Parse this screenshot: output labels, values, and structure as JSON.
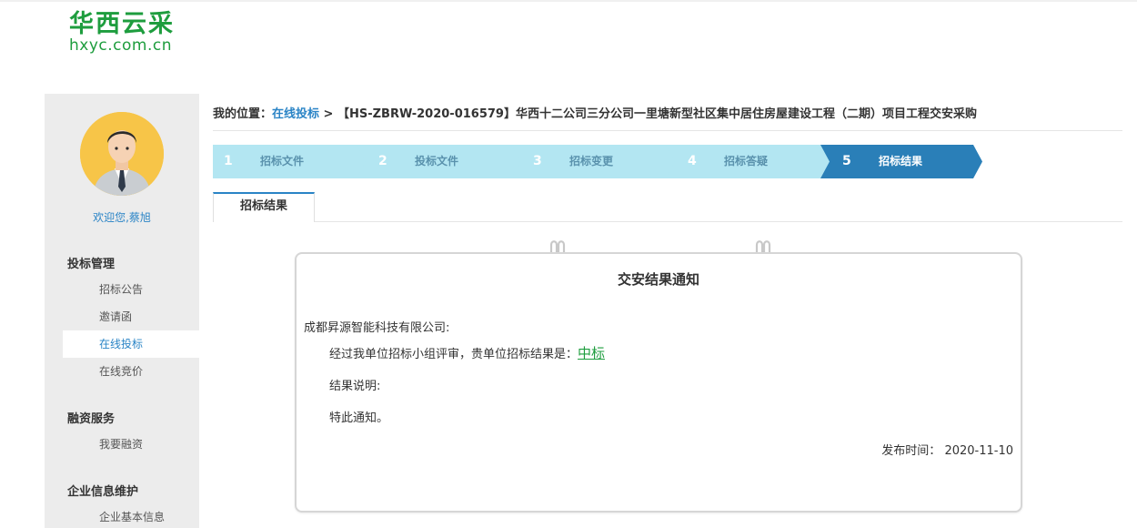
{
  "logo": {
    "cn": "华西云采",
    "en": "hxyc.com.cn"
  },
  "sidebar": {
    "welcome": "欢迎您,蔡旭",
    "groups": [
      {
        "title": "投标管理",
        "items": [
          "招标公告",
          "邀请函",
          "在线投标",
          "在线竞价"
        ]
      },
      {
        "title": "融资服务",
        "items": [
          "我要融资"
        ]
      },
      {
        "title": "企业信息维护",
        "items": [
          "企业基本信息"
        ]
      }
    ],
    "active_item": "在线投标"
  },
  "breadcrumb": {
    "prefix": "我的位置：",
    "link": "在线投标",
    "separator": " > ",
    "current": "【HS-ZBRW-2020-016579】华西十二公司三分公司一里塘新型社区集中居住房屋建设工程（二期）项目工程交安采购"
  },
  "steps": [
    {
      "num": "1",
      "label": "招标文件"
    },
    {
      "num": "2",
      "label": "投标文件"
    },
    {
      "num": "3",
      "label": "招标变更"
    },
    {
      "num": "4",
      "label": "招标答疑"
    },
    {
      "num": "5",
      "label": "招标结果"
    }
  ],
  "active_step": 5,
  "tab": {
    "label": "招标结果"
  },
  "notice": {
    "title": "交安结果通知",
    "company": "成都昇源智能科技有限公司:",
    "line1_prefix": "经过我单位招标小组评审，贵单位招标结果是：",
    "result": "中标",
    "explain": "结果说明:",
    "closing": "特此通知。",
    "pub_label": "发布时间：",
    "pub_date": "2020-11-10"
  },
  "colors": {
    "brand_green": "#1e9d3e",
    "link_blue": "#2a84c6",
    "step_inactive": "#b3e6f2",
    "step_active": "#2a7fb8"
  }
}
